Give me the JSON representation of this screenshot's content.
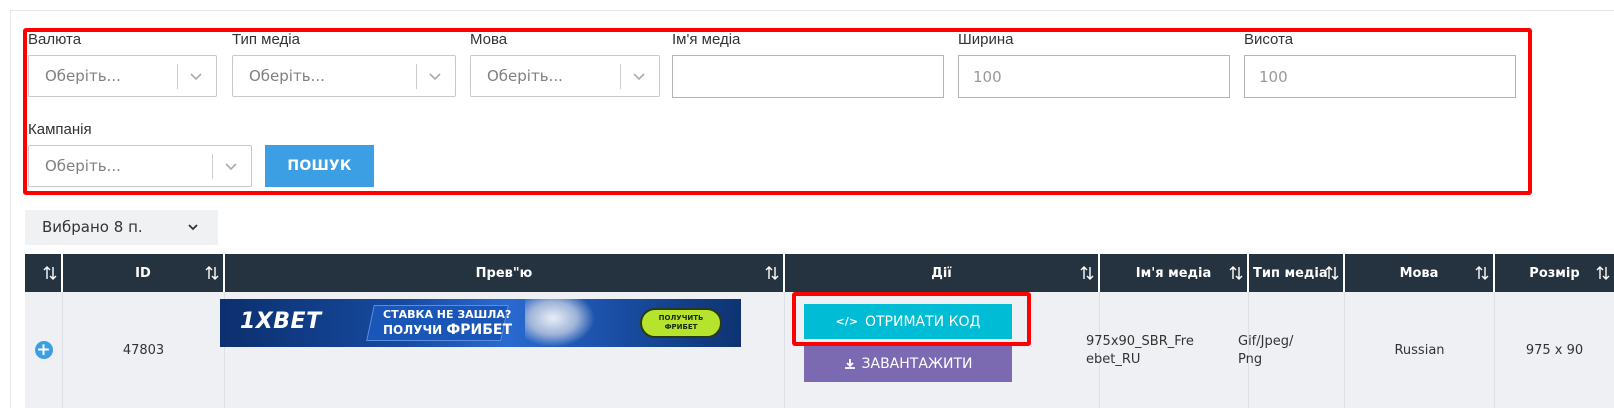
{
  "filters": {
    "currency": {
      "label": "Валюта",
      "placeholder": "Оберіть..."
    },
    "media_type": {
      "label": "Тип медіа",
      "placeholder": "Оберіть..."
    },
    "language": {
      "label": "Мова",
      "placeholder": "Оберіть..."
    },
    "media_name": {
      "label": "Ім'я медіа",
      "value": ""
    },
    "width": {
      "label": "Ширина",
      "placeholder": "100"
    },
    "height": {
      "label": "Висота",
      "placeholder": "100"
    },
    "campaign": {
      "label": "Кампанія",
      "placeholder": "Оберіть..."
    },
    "search_label": "ПОШУК"
  },
  "selected_count_label": "Вибрано 8 п.",
  "table": {
    "headers": {
      "id": "ID",
      "preview": "Прев\"ю",
      "actions": "Дії",
      "media_name": "Ім'я медіа",
      "media_type": "Тип медіа",
      "language": "Мова",
      "size": "Розмір"
    },
    "row": {
      "id": "47803",
      "media_name_line1": "975x90_SBR_Fre",
      "media_name_line2": "ebet_RU",
      "media_type_line1": "Gif/Jpeg/",
      "media_type_line2": "Png",
      "language": "Russian",
      "size": "975 x 90",
      "get_code_label": "ОТРИМАТИ КОД",
      "download_label": "ЗАВАНТАЖИТИ"
    },
    "banner": {
      "brand": "1XBET",
      "tag_line1": "СТАВКА НЕ ЗАШЛА?",
      "tag_line2_prefix": "ПОЛУЧИ",
      "tag_line2_bold": "ФРИБЕТ",
      "cta_line1": "ПОЛУЧИТЬ",
      "cta_line2": "ФРИБЕТ"
    }
  },
  "colors": {
    "highlight": "#ff0000",
    "search_button": "#3c9ee3",
    "header_bg": "#253240",
    "get_code_button": "#00bcd4",
    "download_button": "#7b6ab2"
  },
  "icons": [
    "chevron-down-icon",
    "sort-icon",
    "plus-circle-icon",
    "code-icon",
    "download-icon"
  ]
}
